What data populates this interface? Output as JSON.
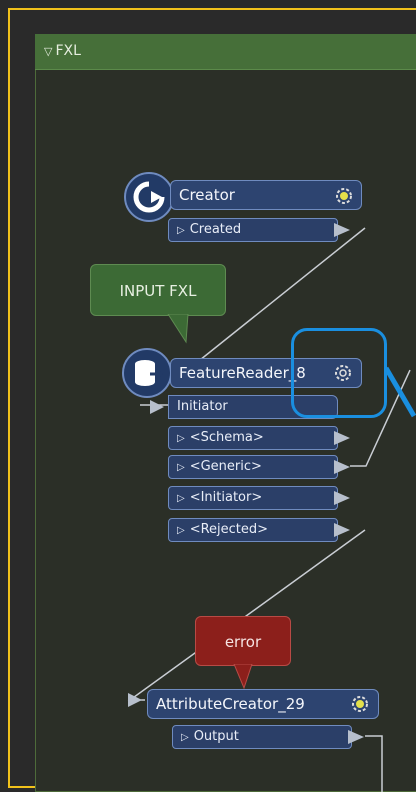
{
  "bookmark": {
    "title": "FXL",
    "collapse_icon": "triangle-down-icon"
  },
  "creator": {
    "name": "Creator",
    "ports": [
      {
        "label": "Created"
      }
    ]
  },
  "feature_reader": {
    "name": "FeatureReader_8",
    "input_port": "Initiator",
    "ports": [
      {
        "label": "<Schema>"
      },
      {
        "label": "<Generic>"
      },
      {
        "label": "<Initiator>"
      },
      {
        "label": "<Rejected>"
      }
    ]
  },
  "attribute_creator": {
    "name": "AttributeCreator_29",
    "ports": [
      {
        "label": "Output"
      }
    ]
  },
  "annotations": {
    "input": "INPUT FXL",
    "error": "error"
  },
  "colors": {
    "frame": "#f2c21b",
    "bookmark_header": "#466f39",
    "transformer": "#2d4470",
    "error_annotation": "#8c1f1b",
    "highlight": "#1a8fe0"
  }
}
